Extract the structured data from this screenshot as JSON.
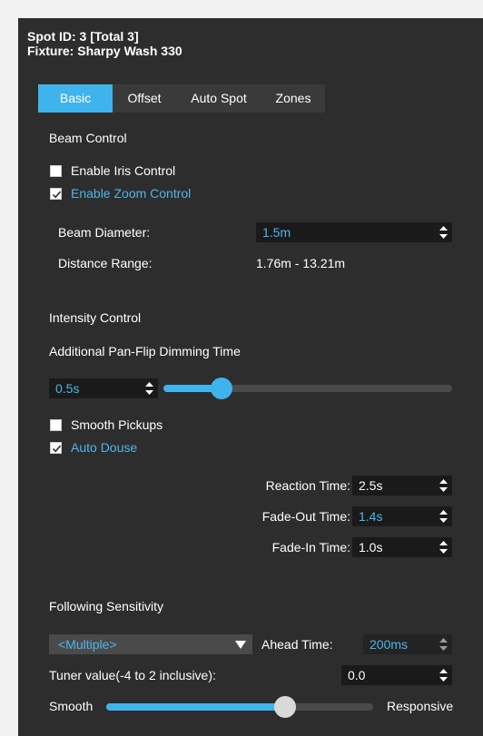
{
  "header": {
    "spot_id": "Spot ID: 3 [Total 3]",
    "fixture": "Fixture: Sharpy Wash 330"
  },
  "tabs": [
    {
      "label": "Basic",
      "active": true
    },
    {
      "label": "Offset",
      "active": false
    },
    {
      "label": "Auto Spot",
      "active": false
    },
    {
      "label": "Zones",
      "active": false
    }
  ],
  "beam_control": {
    "title": "Beam Control",
    "enable_iris": {
      "label": "Enable Iris Control",
      "checked": false
    },
    "enable_zoom": {
      "label": "Enable Zoom Control",
      "checked": true
    },
    "beam_diameter": {
      "label": "Beam Diameter:",
      "value": "1.5m"
    },
    "distance_range": {
      "label": "Distance Range:",
      "value": "1.76m - 13.21m"
    }
  },
  "intensity_control": {
    "title": "Intensity Control",
    "pan_flip_label": "Additional Pan-Flip Dimming Time",
    "pan_flip_value": "0.5s",
    "pan_flip_slider_level": 0.2,
    "smooth_pickups": {
      "label": "Smooth Pickups",
      "checked": false
    },
    "auto_douse": {
      "label": "Auto Douse",
      "checked": true
    },
    "reaction_time": {
      "label": "Reaction Time:",
      "value": "2.5s"
    },
    "fade_out_time": {
      "label": "Fade-Out Time:",
      "value": "1.4s"
    },
    "fade_in_time": {
      "label": "Fade-In Time:",
      "value": "1.0s"
    }
  },
  "following_sensitivity": {
    "title": "Following Sensitivity",
    "preset_value": "<Multiple>",
    "ahead_time_label": "Ahead Time:",
    "ahead_time_value": "200ms",
    "tuner_label": "Tuner value(-4 to 2 inclusive):",
    "tuner_value": "0.0",
    "slider_left_label": "Smooth",
    "slider_right_label": "Responsive",
    "slider_level": 0.67
  },
  "colors": {
    "accent": "#3fb4ec",
    "panel_bg": "#2d2d2d",
    "field_bg": "#1a1a1a",
    "knob": "#3fb4ec",
    "knob_disabled": "#d9d9d9"
  }
}
